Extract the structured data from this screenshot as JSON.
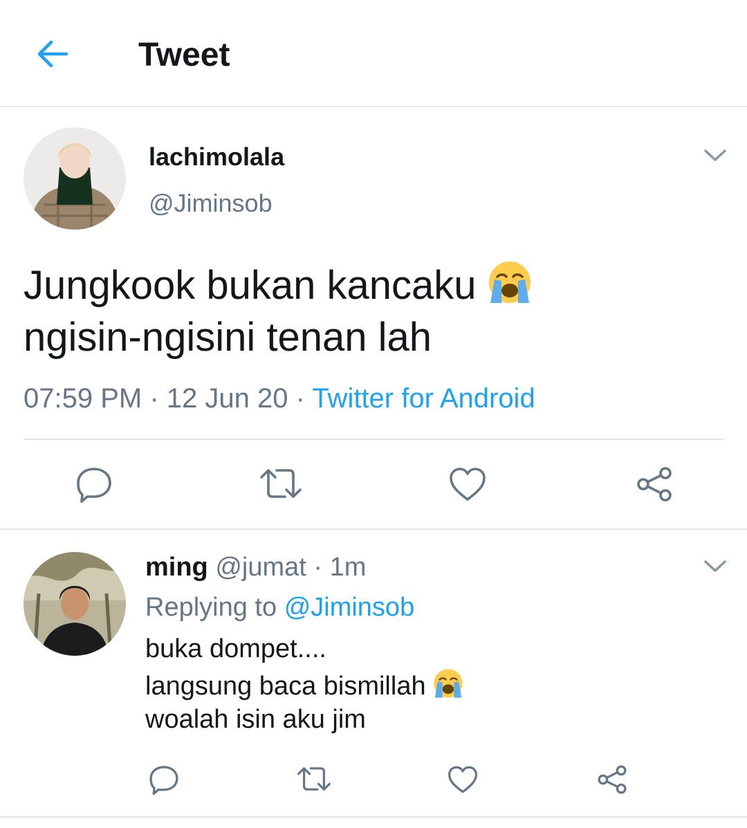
{
  "header": {
    "title": "Tweet"
  },
  "tweet": {
    "display_name": "lachimolala",
    "handle": "@Jiminsob",
    "text_line1": "Jungkook bukan kancaku",
    "text_line2": "ngisin-ngisini tenan lah",
    "emoji": "loudly-crying-face",
    "time": "07:59 PM",
    "date": "12 Jun 20",
    "source": "Twitter for Android"
  },
  "reply": {
    "display_name": "ming",
    "handle": "@jumat",
    "age": "1m",
    "replying_prefix": "Replying to",
    "replying_to": "@Jiminsob",
    "line1": "buka dompet....",
    "line2": "langsung baca bismillah",
    "line3": "woalah isin aku jim",
    "emoji": "loudly-crying-face"
  },
  "colors": {
    "accent": "#1da1f2",
    "text": "#14171a",
    "secondary": "#657786",
    "divider": "#e1e8ed"
  },
  "icons": [
    "back-arrow-icon",
    "chevron-down-icon",
    "reply-icon",
    "retweet-icon",
    "like-icon",
    "share-icon"
  ]
}
